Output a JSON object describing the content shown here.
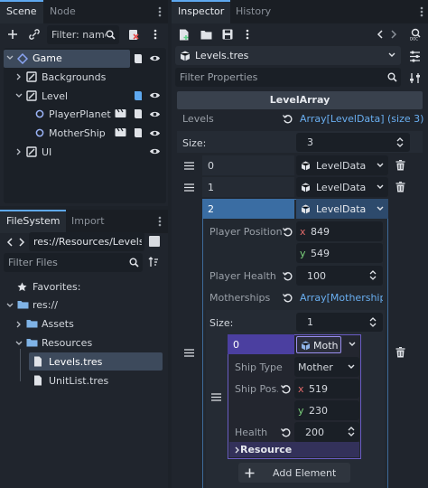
{
  "scene_dock": {
    "tabs": [
      "Scene",
      "Node"
    ],
    "filter_placeholder": "Filter: name,",
    "tree": [
      {
        "label": "Game"
      },
      {
        "label": "Backgrounds"
      },
      {
        "label": "Level"
      },
      {
        "label": "PlayerPlanet"
      },
      {
        "label": "MotherShip"
      },
      {
        "label": "UI"
      }
    ]
  },
  "filesystem": {
    "tabs": [
      "FileSystem",
      "Import"
    ],
    "path": "res://Resources/Levels.t",
    "filter_placeholder": "Filter Files",
    "items": [
      {
        "label": "Favorites:"
      },
      {
        "label": "res://"
      },
      {
        "label": "Assets"
      },
      {
        "label": "Resources"
      },
      {
        "label": "Levels.tres"
      },
      {
        "label": "UnitList.tres"
      }
    ]
  },
  "inspector": {
    "tabs": [
      "Inspector",
      "History"
    ],
    "resource_name": "Levels.tres",
    "filter_placeholder": "Filter Properties",
    "section_title": "LevelArray",
    "levels_label": "Levels",
    "levels_value": "Array[LevelData] (size 3)",
    "size_label": "Size:",
    "size_value": "3",
    "elements": [
      {
        "index": "0",
        "type": "LevelData"
      },
      {
        "index": "1",
        "type": "LevelData"
      },
      {
        "index": "2",
        "type": "LevelData"
      }
    ],
    "player_position_label": "Player Position",
    "player_position": {
      "x_label": "x",
      "x": "849",
      "y_label": "y",
      "y": "549"
    },
    "player_health_label": "Player Health",
    "player_health": "100",
    "motherships_label": "Motherships",
    "motherships_value": "Array[Mothership",
    "inner_size_label": "Size:",
    "inner_size_value": "1",
    "inner_index": "0",
    "inner_type": "Moth",
    "ship_type_label": "Ship Type",
    "ship_type_value": "Mother",
    "ship_pos_label": "Ship Pos...",
    "ship_pos": {
      "x_label": "x",
      "x": "519",
      "y_label": "y",
      "y": "230"
    },
    "health_label": "Health",
    "health_value": "200",
    "resource_label": "Resource",
    "add_element_label": "Add Element"
  },
  "colors": {
    "accent": "#5ea8ef",
    "node_2d": "#9bb4f7",
    "selection": "#3d4a5c"
  }
}
